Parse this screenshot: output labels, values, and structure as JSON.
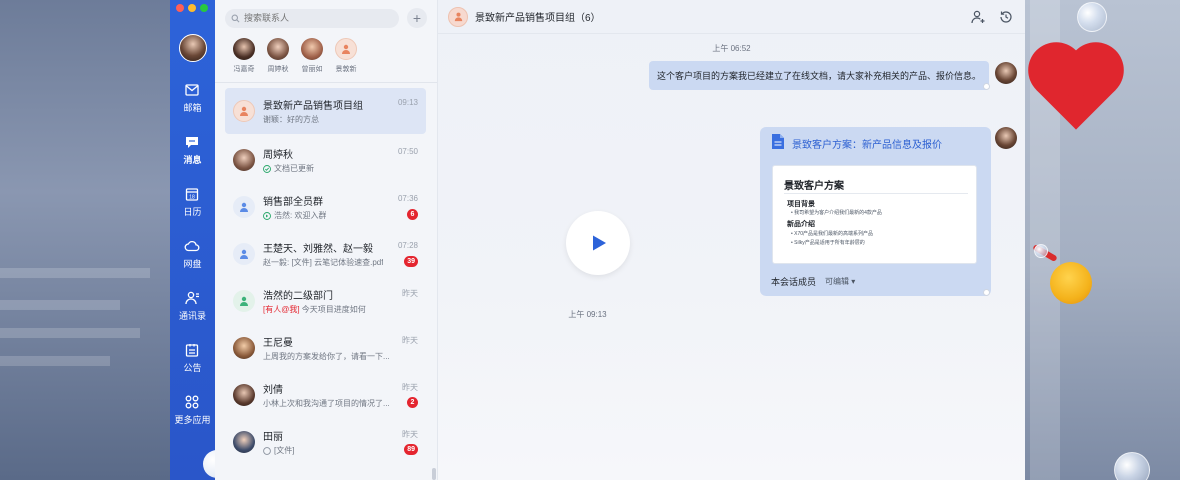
{
  "nav": {
    "items": [
      {
        "label": "邮箱",
        "icon": "mail-icon"
      },
      {
        "label": "消息",
        "icon": "message-icon"
      },
      {
        "label": "日历",
        "icon": "calendar-icon"
      },
      {
        "label": "网盘",
        "icon": "cloud-icon"
      },
      {
        "label": "通讯录",
        "icon": "contacts-icon"
      },
      {
        "label": "公告",
        "icon": "announcement-icon"
      },
      {
        "label": "更多应用",
        "icon": "apps-grid-icon"
      }
    ],
    "calendar_day": "18"
  },
  "search": {
    "placeholder": "搜索联系人"
  },
  "quick_contacts": [
    {
      "name": "冯嘉奇"
    },
    {
      "name": "周婷秋"
    },
    {
      "name": "曾丽如"
    },
    {
      "name": "景敦新"
    }
  ],
  "conversations": [
    {
      "title": "景致新产品销售项目组",
      "time": "09:13",
      "preview": "谢颖：好的方总"
    },
    {
      "title": "周婷秋",
      "time": "07:50",
      "preview": "文档已更新"
    },
    {
      "title": "销售部全员群",
      "time": "07:36",
      "preview": "浩然: 欢迎入群",
      "badge": "6"
    },
    {
      "title": "王楚天、刘雅然、赵一毅",
      "time": "07:28",
      "preview": "赵一毅: [文件] 云笔记体验速查.pdf",
      "badge": "39"
    },
    {
      "title": "浩然的二级部门",
      "time": "昨天",
      "mention": "[有人@我]",
      "preview": " 今天项目进度如何"
    },
    {
      "title": "王尼曼",
      "time": "昨天",
      "preview": "上周我的方案发给你了，请看一下..."
    },
    {
      "title": "刘倩",
      "time": "昨天",
      "preview": "小林上次和我沟通了项目的情况了...",
      "badge": "2"
    },
    {
      "title": "田丽",
      "time": "昨天",
      "preview": "[文件]",
      "badge": "89"
    }
  ],
  "chat": {
    "title": "景致新产品销售项目组（6）",
    "time_1": "上午 06:52",
    "message_1": "这个客户项目的方案我已经建立了在线文档，请大家补充相关的产品、报价信息。",
    "doc": {
      "title": "景致客户方案：新产品信息及报价",
      "preview_title": "景致客户方案",
      "section_1": "项目背景",
      "section_1_line": "• 我司希望为客户介绍我们最新的4款产品",
      "section_2": "新品介绍",
      "section_2_line_1": "• X70产品是我们最新的高端系列产品",
      "section_2_line_2": "• Silky产品是适用于所有年龄层的",
      "footer": "本会话成员",
      "permission": "可编辑"
    },
    "time_2": "上午 09:13"
  },
  "colors": {
    "nav_blue": "#2d63d9",
    "badge_red": "#e4252f",
    "bubble_blue": "#cbd9f2",
    "link_blue": "#2b5fd1"
  }
}
